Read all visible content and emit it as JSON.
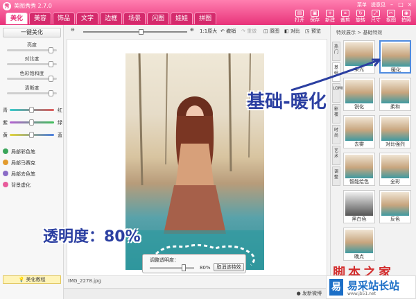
{
  "app": {
    "title": "美图秀秀 2.7.0",
    "logo": "秀"
  },
  "tabs": [
    "美化",
    "美容",
    "饰品",
    "文字",
    "边框",
    "场景",
    "闪图",
    "娃娃",
    "拼图"
  ],
  "top_links": {
    "menu": "菜单",
    "feedback": "提意见"
  },
  "tools": [
    {
      "icon": "open-icon",
      "label": "打开"
    },
    {
      "icon": "save-icon",
      "label": "保存"
    },
    {
      "icon": "new-icon",
      "label": "新建"
    },
    {
      "icon": "crop-icon",
      "label": "裁剪"
    },
    {
      "icon": "rotate-icon",
      "label": "旋转"
    },
    {
      "icon": "resize-icon",
      "label": "尺寸"
    },
    {
      "icon": "matting-icon",
      "label": "抠图"
    },
    {
      "icon": "capture-icon",
      "label": "拍照"
    }
  ],
  "left": {
    "one_key": "一键美化",
    "sliders": [
      {
        "label": "亮度",
        "value": 0.5
      },
      {
        "label": "对比度",
        "value": 0.5
      },
      {
        "label": "色彩饱和度",
        "value": 0.5
      },
      {
        "label": "清晰度",
        "value": 0.5
      }
    ],
    "color_sliders": [
      {
        "left": "青",
        "right": "红",
        "value": 0.5,
        "color": "#e05a5a"
      },
      {
        "left": "紫",
        "right": "绿",
        "value": 0.5,
        "color": "#3fbf5a"
      },
      {
        "left": "黄",
        "right": "蓝",
        "value": 0.5,
        "color": "#4c7fe0"
      }
    ],
    "features": [
      "局部彩色笔",
      "局部马赛克",
      "局部去色笔",
      "背景虚化"
    ],
    "tutorial": "美化教程"
  },
  "toolbar": {
    "zoom_text": "1:1原大",
    "undo": "撤销",
    "redo": "重做",
    "original": "原图",
    "compare": "对比",
    "preview": "预览"
  },
  "file": {
    "name": "IMG_2278.jpg"
  },
  "status": {
    "share": "发新微博"
  },
  "popup": {
    "label": "调整透明度：",
    "value": "80%",
    "cancel": "取消该特效"
  },
  "right": {
    "breadcrumb": "特效展示 > 基础特效",
    "vtabs": [
      "热门",
      "基础",
      "LOMO",
      "影楼",
      "时尚",
      "艺术",
      "调整"
    ],
    "thumbs": [
      {
        "label": "柔光"
      },
      {
        "label": "暖化",
        "selected": true
      },
      {
        "label": "锐化"
      },
      {
        "label": "柔和"
      },
      {
        "label": "去雾"
      },
      {
        "label": "对比强烈"
      },
      {
        "label": "智能绘色"
      },
      {
        "label": "全彩"
      },
      {
        "label": "黑白色",
        "bw": true
      },
      {
        "label": "反色"
      },
      {
        "label": "晚点"
      }
    ]
  },
  "annotations": {
    "effect": "基础-暖化",
    "opacity": "透明度：80%"
  },
  "watermark": {
    "text": "脚本之家",
    "brand": "易采站长站",
    "url": "www.jb51.net"
  }
}
